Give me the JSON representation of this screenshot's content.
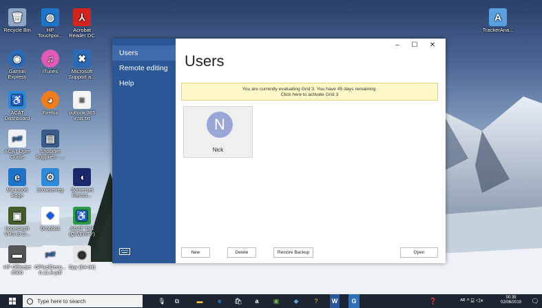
{
  "desktop": {
    "icons": [
      {
        "label": "Recycle Bin"
      },
      {
        "label": "HP Touchpoi..."
      },
      {
        "label": "Acrobat Reader DC"
      },
      {
        "label": "Garmin Express"
      },
      {
        "label": "iTunes"
      },
      {
        "label": "Microsoft Support a..."
      },
      {
        "label": "ACAT Dashboard"
      },
      {
        "label": "Firefox"
      },
      {
        "label": "outlook 365 instr.txt"
      },
      {
        "label": "ACAT User Guide"
      },
      {
        "label": "Shopifier Supplies - ..."
      },
      {
        "label": "Microsoft Edge"
      },
      {
        "label": "browserreg"
      },
      {
        "label": "Somerset Remot..."
      },
      {
        "label": "honestech VHS to D..."
      },
      {
        "label": "Dropbox"
      },
      {
        "label": "ACAT Talk (QWERTY)"
      },
      {
        "label": "HP Officejet 6500"
      },
      {
        "label": "GPixelDeco... 0.11.8.pdf"
      },
      {
        "label": "Spy (64-bit)"
      },
      {
        "label": "TrackerAna..."
      }
    ]
  },
  "app": {
    "sidebar": {
      "items": [
        {
          "label": "Users"
        },
        {
          "label": "Remote editing"
        },
        {
          "label": "Help"
        }
      ]
    },
    "window_controls": {
      "minimize": "–",
      "maximize": "☐",
      "close": "✕"
    },
    "page_title": "Users",
    "banner": {
      "line1": "You are currently evaluating Grid 3.  You have 45 days remaining.",
      "line2": "Click here to activate Grid 3"
    },
    "user_tile": {
      "initial": "N",
      "name": "Nick"
    },
    "buttons": {
      "new": "New",
      "delete": "Delete",
      "restore_backup": "Restore Backup",
      "open": "Open"
    }
  },
  "taskbar": {
    "search_placeholder": "Type here to search",
    "clock_time": "00:39",
    "clock_date": "02/06/2019",
    "tray_glyphs": "ᴬᴿ  ^  ⌸  ◁×"
  }
}
